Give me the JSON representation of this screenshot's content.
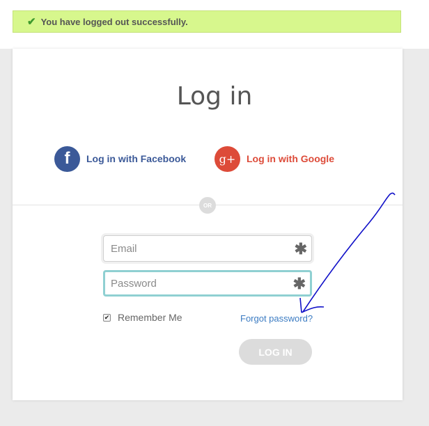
{
  "alert": {
    "message": "You have logged out successfully.",
    "icon": "checkmark-icon"
  },
  "login": {
    "title": "Log in",
    "social": {
      "facebook": {
        "label": "Log in with Facebook",
        "icon_glyph": "f",
        "color": "#3b5998"
      },
      "google": {
        "label": "Log in with Google",
        "icon_glyph": "g+",
        "color": "#dd4b39"
      }
    },
    "divider_label": "OR",
    "fields": {
      "email": {
        "placeholder": "Email",
        "value": "",
        "required_marker": "✱"
      },
      "password": {
        "placeholder": "Password",
        "value": "",
        "required_marker": "✱"
      }
    },
    "remember_me": {
      "label": "Remember Me",
      "checked": true
    },
    "forgot_password": "Forgot password?",
    "submit_label": "LOG IN"
  },
  "colors": {
    "alert_bg": "#d7f78d",
    "focus_border": "#8fd0d2",
    "link": "#3b7bc2",
    "annotation": "#1010c8"
  }
}
